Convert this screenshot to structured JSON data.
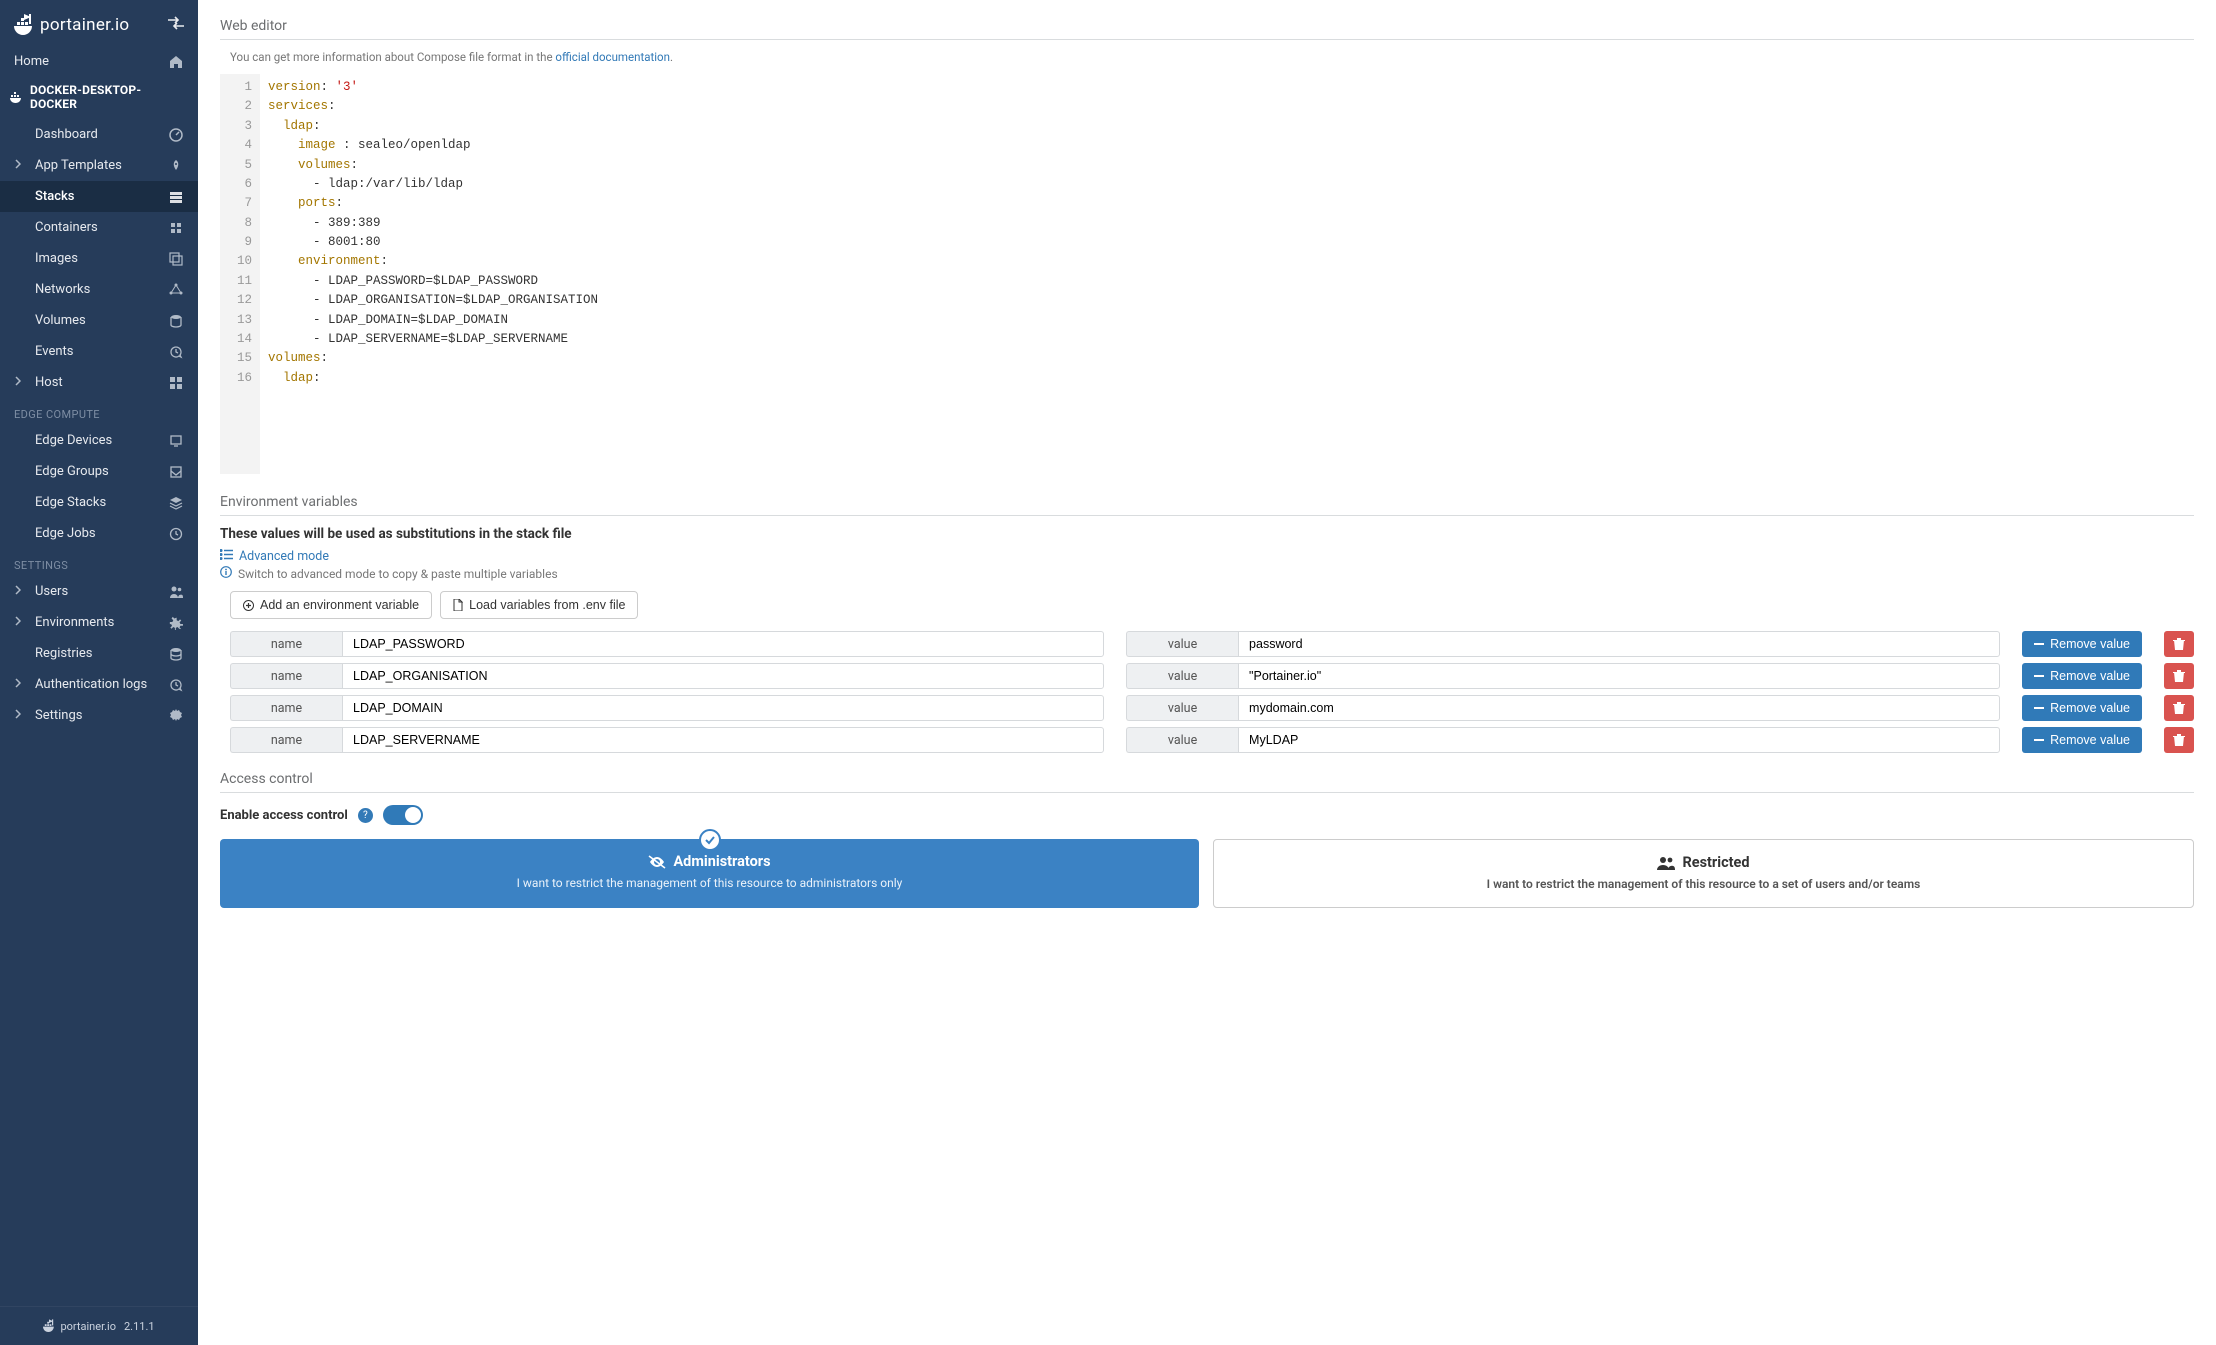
{
  "brand": "portainer.io",
  "version": "2.11.1",
  "sidebar": {
    "home": "Home",
    "env_header": "DOCKER-DESKTOP-DOCKER",
    "items": [
      {
        "label": "Dashboard",
        "icon": "dashboard",
        "name": "dashboard"
      },
      {
        "label": "App Templates",
        "icon": "rocket",
        "name": "app-templates",
        "expandable": true
      },
      {
        "label": "Stacks",
        "icon": "stacks",
        "name": "stacks",
        "active": true
      },
      {
        "label": "Containers",
        "icon": "containers",
        "name": "containers"
      },
      {
        "label": "Images",
        "icon": "images",
        "name": "images"
      },
      {
        "label": "Networks",
        "icon": "networks",
        "name": "networks"
      },
      {
        "label": "Volumes",
        "icon": "volumes",
        "name": "volumes"
      },
      {
        "label": "Events",
        "icon": "events",
        "name": "events"
      },
      {
        "label": "Host",
        "icon": "host",
        "name": "host",
        "expandable": true
      }
    ],
    "edge_title": "EDGE COMPUTE",
    "edge_items": [
      {
        "label": "Edge Devices",
        "icon": "device",
        "name": "edge-devices"
      },
      {
        "label": "Edge Groups",
        "icon": "group",
        "name": "edge-groups"
      },
      {
        "label": "Edge Stacks",
        "icon": "layers",
        "name": "edge-stacks"
      },
      {
        "label": "Edge Jobs",
        "icon": "clock",
        "name": "edge-jobs"
      }
    ],
    "settings_title": "SETTINGS",
    "settings_items": [
      {
        "label": "Users",
        "icon": "users",
        "name": "users",
        "expandable": true
      },
      {
        "label": "Environments",
        "icon": "envs",
        "name": "environments",
        "expandable": true
      },
      {
        "label": "Registries",
        "icon": "registries",
        "name": "registries"
      },
      {
        "label": "Authentication logs",
        "icon": "authlogs",
        "name": "authentication-logs",
        "expandable": true
      },
      {
        "label": "Settings",
        "icon": "settings",
        "name": "settings",
        "expandable": true
      }
    ]
  },
  "editor": {
    "section_title": "Web editor",
    "help_prefix": "You can get more information about Compose file format in the ",
    "help_link": "official documentation",
    "help_suffix": ".",
    "lines": [
      {
        "n": 1,
        "t": [
          [
            "k",
            "version"
          ],
          [
            "p",
            ": "
          ],
          [
            "s",
            "'3'"
          ]
        ]
      },
      {
        "n": 2,
        "t": [
          [
            "k",
            "services"
          ],
          [
            "p",
            ":"
          ]
        ]
      },
      {
        "n": 3,
        "t": [
          [
            "p",
            "  "
          ],
          [
            "k",
            "ldap"
          ],
          [
            "p",
            ":"
          ]
        ]
      },
      {
        "n": 4,
        "t": [
          [
            "p",
            "    "
          ],
          [
            "k",
            "image "
          ],
          [
            "p",
            ": sealeo/openldap"
          ]
        ]
      },
      {
        "n": 5,
        "t": [
          [
            "p",
            "    "
          ],
          [
            "k",
            "volumes"
          ],
          [
            "p",
            ":"
          ]
        ]
      },
      {
        "n": 6,
        "t": [
          [
            "p",
            "      - ldap:/var/lib/ldap"
          ]
        ]
      },
      {
        "n": 7,
        "t": [
          [
            "p",
            "    "
          ],
          [
            "k",
            "ports"
          ],
          [
            "p",
            ":"
          ]
        ]
      },
      {
        "n": 8,
        "t": [
          [
            "p",
            "      - 389:389"
          ]
        ]
      },
      {
        "n": 9,
        "t": [
          [
            "p",
            "      - 8001:80"
          ]
        ]
      },
      {
        "n": 10,
        "t": [
          [
            "p",
            "    "
          ],
          [
            "k",
            "environment"
          ],
          [
            "p",
            ":"
          ]
        ]
      },
      {
        "n": 11,
        "t": [
          [
            "p",
            "      - LDAP_PASSWORD=$LDAP_PASSWORD"
          ]
        ]
      },
      {
        "n": 12,
        "t": [
          [
            "p",
            "      - LDAP_ORGANISATION=$LDAP_ORGANISATION"
          ]
        ]
      },
      {
        "n": 13,
        "t": [
          [
            "p",
            "      - LDAP_DOMAIN=$LDAP_DOMAIN"
          ]
        ]
      },
      {
        "n": 14,
        "t": [
          [
            "p",
            "      - LDAP_SERVERNAME=$LDAP_SERVERNAME"
          ]
        ]
      },
      {
        "n": 15,
        "t": [
          [
            "k",
            "volumes"
          ],
          [
            "p",
            ":"
          ]
        ]
      },
      {
        "n": 16,
        "t": [
          [
            "p",
            "  "
          ],
          [
            "k",
            "ldap"
          ],
          [
            "p",
            ":"
          ]
        ]
      }
    ]
  },
  "env": {
    "section_title": "Environment variables",
    "subheading": "These values will be used as substitutions in the stack file",
    "adv_link": "Advanced mode",
    "adv_note": "Switch to advanced mode to copy & paste multiple variables",
    "add_btn": "Add an environment variable",
    "load_btn": "Load variables from .env file",
    "name_label": "name",
    "value_label": "value",
    "remove_label": "Remove value",
    "rows": [
      {
        "name": "LDAP_PASSWORD",
        "value": "password"
      },
      {
        "name": "LDAP_ORGANISATION",
        "value": "\"Portainer.io\""
      },
      {
        "name": "LDAP_DOMAIN",
        "value": "mydomain.com"
      },
      {
        "name": "LDAP_SERVERNAME",
        "value": "MyLDAP"
      }
    ]
  },
  "access": {
    "section_title": "Access control",
    "toggle_label": "Enable access control",
    "admin_title": "Administrators",
    "admin_desc": "I want to restrict the management of this resource to administrators only",
    "restricted_title": "Restricted",
    "restricted_desc": "I want to restrict the management of this resource to a set of users and/or teams"
  }
}
